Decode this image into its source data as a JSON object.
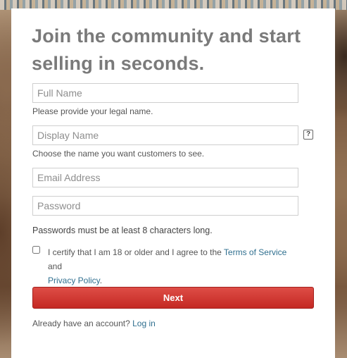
{
  "form": {
    "headline": "Join the community and start selling in seconds.",
    "full_name": {
      "placeholder": "Full Name",
      "value": "",
      "hint": "Please provide your legal name."
    },
    "display_name": {
      "placeholder": "Display Name",
      "value": "",
      "hint": "Choose the name you want customers to see.",
      "help_icon": "?"
    },
    "email": {
      "placeholder": "Email Address",
      "value": ""
    },
    "password": {
      "placeholder": "Password",
      "value": "",
      "note": "Passwords must be at least 8 characters long."
    },
    "certify": {
      "checked": false,
      "text_before": "I certify that I am 18 or older and I agree to the ",
      "terms_link": "Terms of Service",
      "text_middle": " and ",
      "privacy_link": "Privacy Policy",
      "text_after": "."
    },
    "next_label": "Next",
    "login_prompt": "Already have an account? ",
    "login_link": "Log in"
  },
  "icons": {
    "help": "question-mark-icon"
  },
  "colors": {
    "primary_button": "#c42923",
    "link": "#2f6f8f",
    "headline": "#7a7a7a"
  }
}
